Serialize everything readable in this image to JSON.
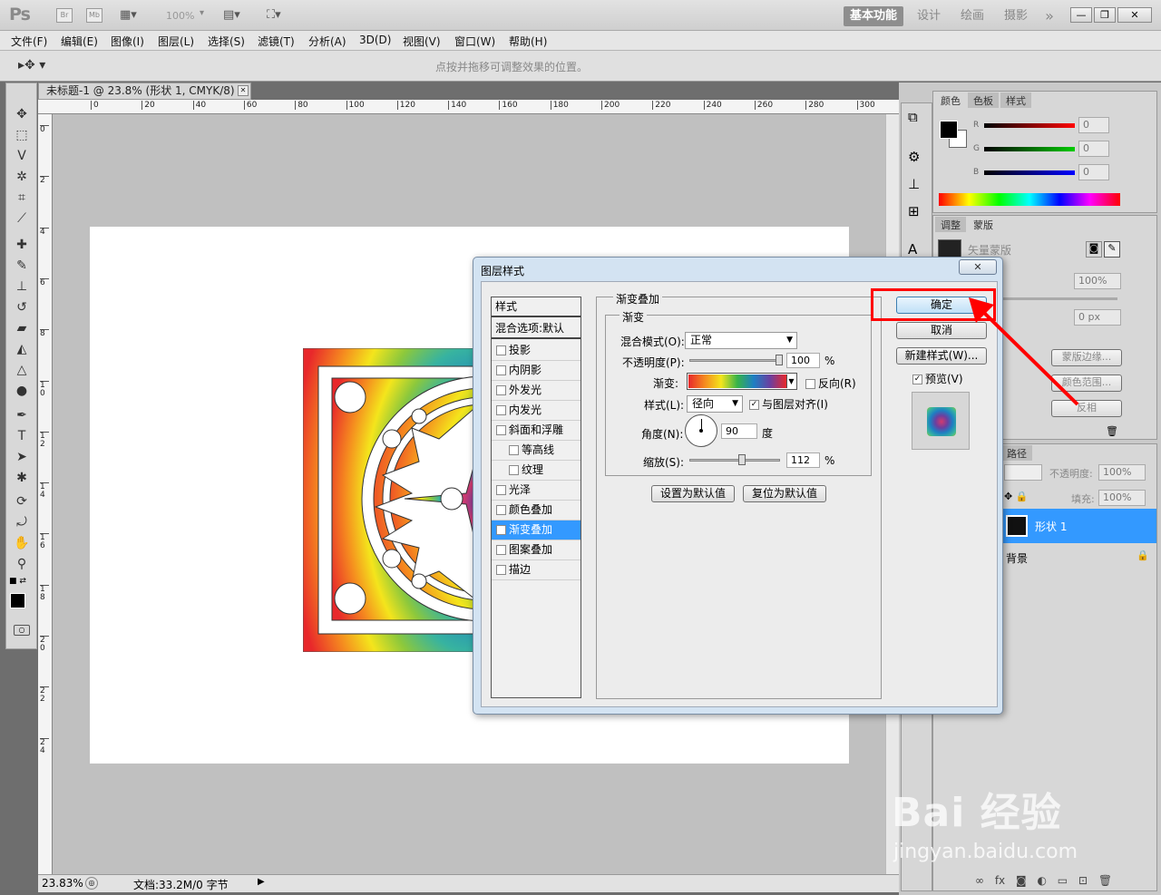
{
  "app": {
    "logo": "Ps",
    "bridge": "Br",
    "minibridge": "Mb",
    "zoom_level": "100%",
    "workspaces": [
      "基本功能",
      "设计",
      "绘画",
      "摄影"
    ],
    "more_workspaces": "»",
    "window_controls": [
      "—",
      "❐",
      "✕"
    ]
  },
  "menu": [
    "文件(F)",
    "编辑(E)",
    "图像(I)",
    "图层(L)",
    "选择(S)",
    "滤镜(T)",
    "分析(A)",
    "3D(D)",
    "视图(V)",
    "窗口(W)",
    "帮助(H)"
  ],
  "options_hint": "点按并拖移可调整效果的位置。",
  "document": {
    "tab_title": "未标题-1 @ 23.8% (形状 1, CMYK/8) *",
    "tab_close": "✕",
    "ruler_h": [
      "0",
      "20",
      "40",
      "60",
      "80",
      "100",
      "120",
      "140",
      "160",
      "180",
      "200",
      "220",
      "240",
      "260",
      "280",
      "300"
    ],
    "ruler_v": [
      "0",
      "2",
      "4",
      "6",
      "8",
      "10",
      "12",
      "14",
      "16",
      "18",
      "20",
      "22",
      "24"
    ],
    "status_zoom": "23.83%",
    "status_doc": "文档:33.2M/0 字节"
  },
  "panels": {
    "color_tabs": [
      "颜色",
      "色板",
      "样式"
    ],
    "color_values": {
      "r_label": "R",
      "g_label": "G",
      "b_label": "B",
      "r": "0",
      "g": "0",
      "b": "0"
    },
    "adjust_tabs": [
      "调整",
      "蒙版"
    ],
    "mask_label": "矢量蒙版",
    "density": "100%",
    "feather": "0 px",
    "mask_buttons": [
      "蒙版边缘...",
      "颜色范围...",
      "反相"
    ],
    "layers_tab": "路径",
    "opacity_label": "不透明度:",
    "opacity": "100%",
    "fill_label": "填充:",
    "fill": "100%",
    "layer_names": [
      "形状 1",
      "背景"
    ],
    "bottom_icons": [
      "fx"
    ]
  },
  "dialog": {
    "title": "图层样式",
    "close": "✕",
    "styles_header": "样式",
    "blend_default": "混合选项:默认",
    "effects": [
      {
        "label": "投影",
        "checked": false,
        "indent": false
      },
      {
        "label": "内阴影",
        "checked": false,
        "indent": false
      },
      {
        "label": "外发光",
        "checked": false,
        "indent": false
      },
      {
        "label": "内发光",
        "checked": false,
        "indent": false
      },
      {
        "label": "斜面和浮雕",
        "checked": false,
        "indent": false
      },
      {
        "label": "等高线",
        "checked": false,
        "indent": true
      },
      {
        "label": "纹理",
        "checked": false,
        "indent": true
      },
      {
        "label": "光泽",
        "checked": false,
        "indent": false
      },
      {
        "label": "颜色叠加",
        "checked": false,
        "indent": false
      },
      {
        "label": "渐变叠加",
        "checked": true,
        "indent": false,
        "selected": true
      },
      {
        "label": "图案叠加",
        "checked": false,
        "indent": false
      },
      {
        "label": "描边",
        "checked": false,
        "indent": false
      }
    ],
    "section_title": "渐变叠加",
    "group_title": "渐变",
    "blend_mode_label": "混合模式(O):",
    "blend_mode": "正常",
    "opacity_label": "不透明度(P):",
    "opacity": "100",
    "opacity_unit": "%",
    "opacity_level": 1.0,
    "gradient_label": "渐变:",
    "reverse_label": "反向(R)",
    "style_label": "样式(L):",
    "style_value": "径向",
    "align_label": "与图层对齐(I)",
    "angle_label": "角度(N):",
    "angle": "90",
    "angle_unit": "度",
    "scale_label": "缩放(S):",
    "scale": "112",
    "scale_unit": "%",
    "scale_level": 0.56,
    "set_default": "设置为默认值",
    "reset_default": "复位为默认值",
    "ok": "确定",
    "cancel": "取消",
    "new_style": "新建样式(W)...",
    "preview_label": "预览(V)"
  },
  "watermark": {
    "brand": "Bai 经验",
    "url": "jingyan.baidu.com"
  },
  "colors": {
    "highlight": "#ff0000",
    "selection": "#3399ff",
    "gradient_stops": [
      "#e8282b",
      "#f58a1f",
      "#f4e51c",
      "#37b34a",
      "#1d7fc3",
      "#6b3fa0",
      "#e8282b"
    ]
  }
}
